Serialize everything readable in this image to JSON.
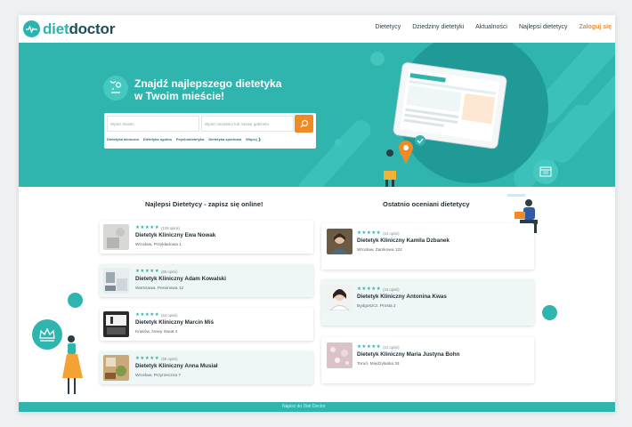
{
  "logo": {
    "part1": "diet",
    "part2": "doctor"
  },
  "nav": {
    "items": [
      "Dietetycy",
      "Dziedziny dietetyki",
      "Aktualności",
      "Najlepsi dietetycy"
    ],
    "login": "Zaloguj się"
  },
  "hero": {
    "title_line1": "Znajdź najlepszego dietetyka",
    "title_line2": "w Twoim mieście!",
    "search": {
      "city_placeholder": "Wpisz miasto",
      "name_placeholder": "Wpisz nazwisko lub nazwę gabinetu"
    },
    "chips": [
      "Dietetyka kliniczna",
      "Dietetyka ogólna",
      "Psychodietetyka",
      "Dietetyka sportowa",
      "Więcej ❯"
    ]
  },
  "best": {
    "title": "Najlepsi Dietetycy - zapisz się online!",
    "items": [
      {
        "reviews": "(109 opinii)",
        "name": "Dietetyk Kliniczny Ewa Nowak",
        "address": "Wrocław, Przykładowa 1"
      },
      {
        "reviews": "(86 opinii)",
        "name": "Dietetyk Kliniczny Adam Kowalski",
        "address": "Warszawa, Pereinowa 12"
      },
      {
        "reviews": "(64 opinii)",
        "name": "Dietetyk Kliniczny Marcin Miś",
        "address": "Kraków, Nowy Świat 4"
      },
      {
        "reviews": "(56 opinii)",
        "name": "Dietetyk Kliniczny Anna Musiał",
        "address": "Wrocław, Przyrzeczna 7"
      }
    ]
  },
  "recent": {
    "title": "Ostatnio oceniani dietetycy",
    "items": [
      {
        "reviews": "(24 opinii)",
        "name": "Dietetyk Kliniczny Kamila Dzbanek",
        "address": "Wrocław, Zamkowa 122"
      },
      {
        "reviews": "(44 opinii)",
        "name": "Dietetyk Kliniczny Antonina Kwas",
        "address": "Bydgoszcz, Prosta 2"
      },
      {
        "reviews": "(21 opinii)",
        "name": "Dietetyk Kliniczny Maria Justyna Bohn",
        "address": "Toruń, Międzylaska 34"
      }
    ]
  },
  "stars": "★★★★★",
  "footer": {
    "text": "Napisz do Diet Doctor"
  },
  "colors": {
    "accent": "#2fb4ae",
    "orange": "#f08a24",
    "dark": "#1f4d5a"
  }
}
